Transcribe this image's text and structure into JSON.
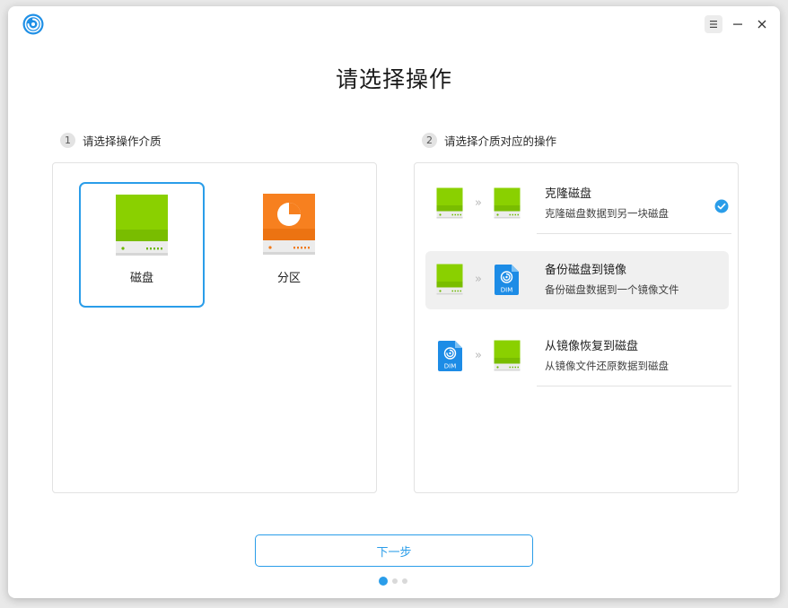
{
  "window": {
    "title_icon": "app-logo-icon",
    "controls": {
      "menu": "menu-icon",
      "minimize": "minimize-icon",
      "close": "close-icon"
    }
  },
  "page_title": "请选择操作",
  "step1": {
    "number": "1",
    "label": "请选择操作介质",
    "media": [
      {
        "label": "磁盘",
        "icon": "disk-icon",
        "selected": true
      },
      {
        "label": "分区",
        "icon": "partition-icon",
        "selected": false
      }
    ]
  },
  "step2": {
    "number": "2",
    "label": "请选择介质对应的操作",
    "operations": [
      {
        "title": "克隆磁盘",
        "description": "克隆磁盘数据到另一块磁盘",
        "from_icon": "disk-icon",
        "to_icon": "disk-icon",
        "checked": true
      },
      {
        "title": "备份磁盘到镜像",
        "description": "备份磁盘数据到一个镜像文件",
        "from_icon": "disk-icon",
        "to_icon": "dim-image-icon",
        "checked": false
      },
      {
        "title": "从镜像恢复到磁盘",
        "description": "从镜像文件还原数据到磁盘",
        "from_icon": "dim-image-icon",
        "to_icon": "disk-icon",
        "checked": false
      }
    ],
    "arrow_glyph": "»",
    "dim_label": "DIM"
  },
  "footer": {
    "next_label": "下一步",
    "pager": {
      "total": 3,
      "current": 1
    }
  },
  "colors": {
    "accent": "#2a9de9",
    "disk_green": "#8ad000",
    "partition_orange": "#f7801f",
    "image_blue": "#1d8ce6"
  }
}
